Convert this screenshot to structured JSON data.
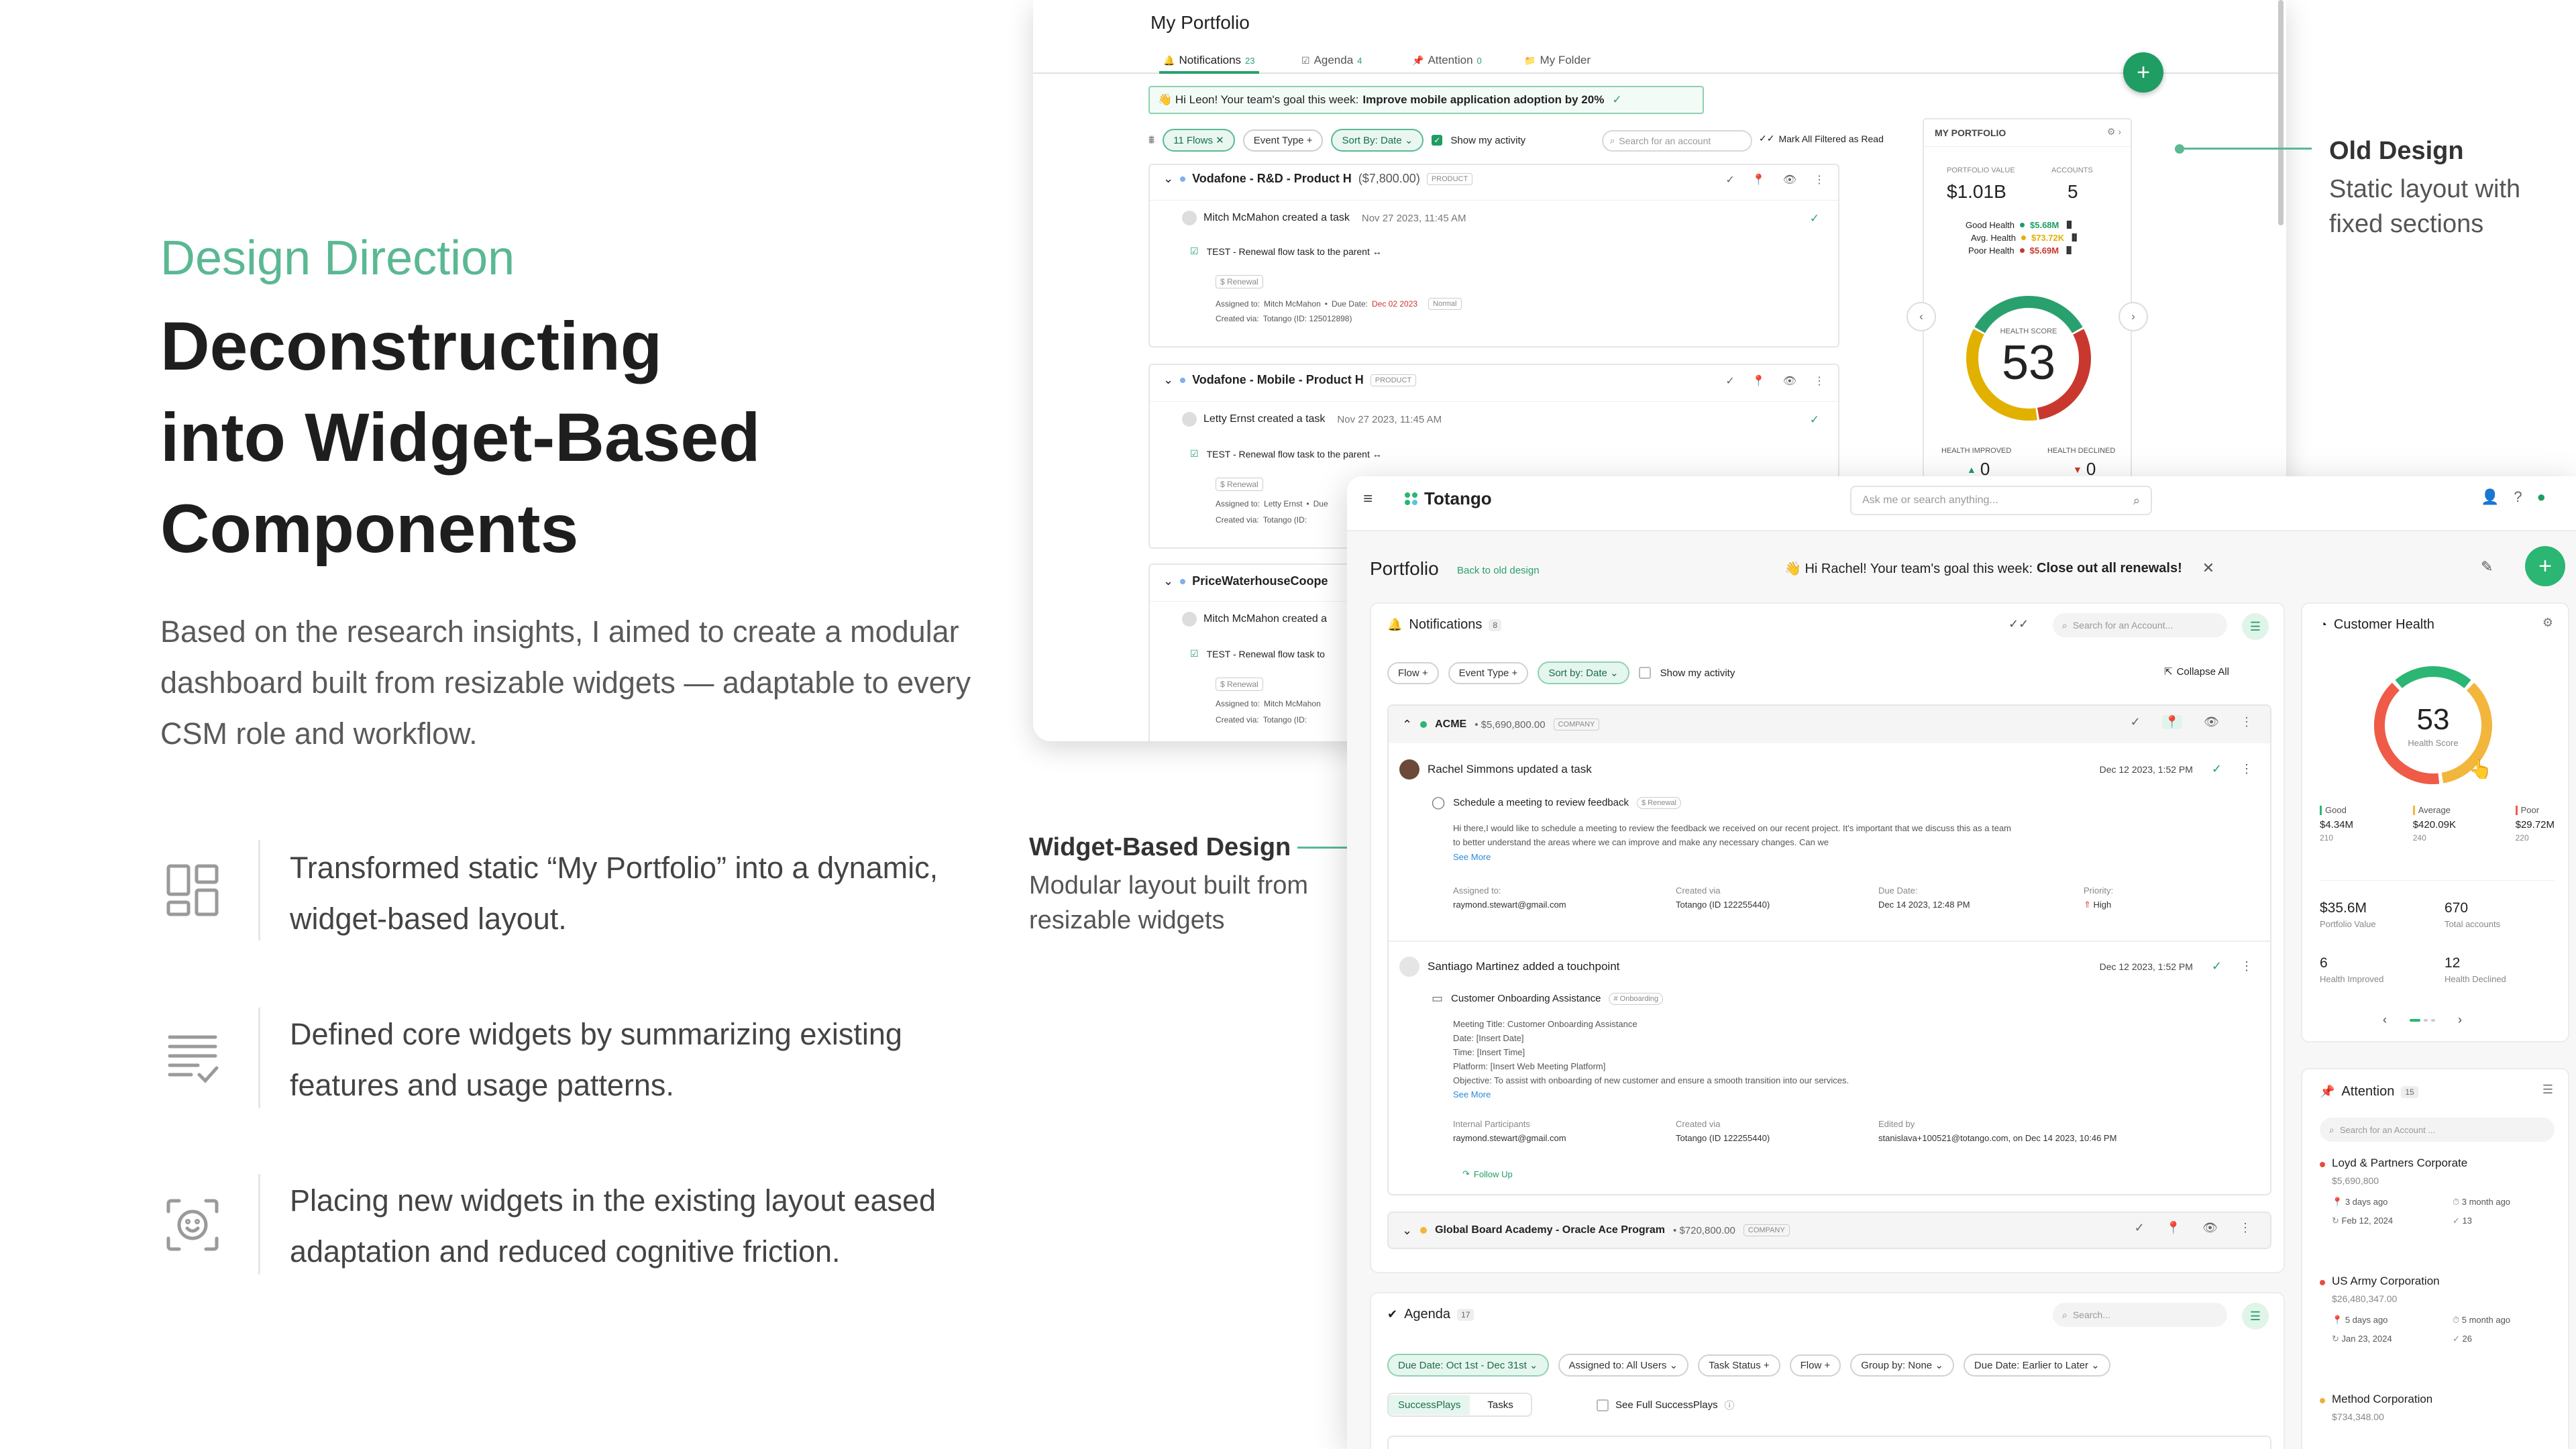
{
  "left": {
    "section_label": "Design Direction",
    "headline_lines": [
      "Deconstructing",
      "into Widget-Based",
      "Components"
    ],
    "intro": "Based on the research insights, I aimed to create a modular dashboard built from resizable widgets — adaptable to every CSM role and workflow.",
    "features": [
      {
        "icon": "widget-grid-icon",
        "text": "Transformed static “My Portfolio” into a dynamic, widget-based layout."
      },
      {
        "icon": "summary-list-icon",
        "text": "Defined core widgets by summarizing existing features and usage patterns."
      },
      {
        "icon": "face-scan-icon",
        "text": "Placing new widgets in the existing layout eased adaptation and reduced cognitive friction."
      }
    ]
  },
  "annotations": {
    "old": {
      "title": "Old Design",
      "desc": "Static layout with fixed sections"
    },
    "new": {
      "title": "Widget-Based Design",
      "desc": "Modular layout built from resizable widgets"
    }
  },
  "accent_color": "#5ab893",
  "old_design": {
    "title": "My Portfolio",
    "tabs": [
      {
        "label": "Notifications",
        "count": "23"
      },
      {
        "label": "Agenda",
        "count": "4"
      },
      {
        "label": "Attention",
        "count": "0"
      },
      {
        "label": "My Folder",
        "count": ""
      }
    ],
    "goal_prefix": "👋 Hi Leon! Your team's goal this week:",
    "goal_bold": "Improve mobile application adoption by 20%",
    "filters": {
      "flows": "11 Flows",
      "event_type": "Event Type",
      "sort": "Sort By: Date",
      "show_activity": "Show my activity",
      "search_placeholder": "Search for an account",
      "mark_all": "Mark All Filtered as Read"
    },
    "groups": [
      {
        "account": "Vodafone - R&D - Product H",
        "amount": "($7,800.00)",
        "tag": "PRODUCT",
        "event": "Mitch McMahon created a task",
        "time": "Nov 27 2023, 11:45 AM",
        "task": "TEST - Renewal flow task to the parent ↔",
        "badge": "$ Renewal",
        "assigned_label": "Assigned to:",
        "assigned": "Mitch McMahon",
        "due_label": "Due Date:",
        "due": "Dec 02 2023",
        "priority": "Normal",
        "created_label": "Created via:",
        "created": "Totango (ID: 125012898)"
      },
      {
        "account": "Vodafone - Mobile - Product H",
        "amount": "",
        "tag": "PRODUCT",
        "event": "Letty Ernst created a task",
        "time": "Nov 27 2023, 11:45 AM",
        "task": "TEST - Renewal flow task to the parent ↔",
        "badge": "$ Renewal",
        "assigned_label": "Assigned to:",
        "assigned": "Letty Ernst",
        "due_label": "Due",
        "due": "",
        "priority": "",
        "created_label": "Created via:",
        "created": "Totango (ID:"
      },
      {
        "account": "PriceWaterhouseCoope",
        "amount": "",
        "tag": "",
        "event": "Mitch McMahon created a",
        "time": "",
        "task": "TEST - Renewal flow task to",
        "badge": "$ Renewal",
        "assigned_label": "Assigned to:",
        "assigned": "Mitch McMahon",
        "due_label": "",
        "due": "",
        "priority": "",
        "created_label": "Created via:",
        "created": "Totango (ID:"
      }
    ],
    "portfolio": {
      "title": "MY PORTFOLIO",
      "value_label": "PORTFOLIO VALUE",
      "value": "$1.01B",
      "accounts_label": "ACCOUNTS",
      "accounts": "5",
      "health_rows": [
        {
          "label": "Good Health",
          "value": "$5.68M",
          "color": "#1f9d63"
        },
        {
          "label": "Avg. Health",
          "value": "$73.72K",
          "color": "#e2b100"
        },
        {
          "label": "Poor Health",
          "value": "$5.69M",
          "color": "#c9382e"
        }
      ],
      "score_label": "HEALTH SCORE",
      "score": "53",
      "improved_label": "HEALTH IMPROVED",
      "improved": "0",
      "declined_label": "HEALTH DECLINED",
      "declined": "0"
    }
  },
  "new_design": {
    "brand": "Totango",
    "search_placeholder": "Ask me or search anything...",
    "page_title": "Portfolio",
    "back_link": "Back to old design",
    "goal_prefix": "👋 Hi Rachel! Your team's goal this week:",
    "goal_bold": "Close out all renewals!",
    "notifications": {
      "title": "Notifications",
      "count": "8",
      "search_placeholder": "Search for an Account...",
      "filters": {
        "flow": "Flow",
        "event_type": "Event Type",
        "sort": "Sort by: Date",
        "show_activity": "Show my activity",
        "collapse": "Collapse All"
      },
      "group1": {
        "account": "ACME",
        "amount": "• $5,690,800.00",
        "tag": "COMPANY"
      },
      "item1": {
        "title": "Rachel Simmons updated a task",
        "time": "Dec 12 2023, 1:52 PM",
        "task": "Schedule a meeting to review feedback",
        "badge": "$ Renewal",
        "body": "Hi there,I would like to schedule a meeting to review the feedback we received on our recent project. It's important that we discuss this as a team to better understand the areas where we can improve and make any necessary changes. Can we",
        "see_more": "See More",
        "fields": [
          {
            "label": "Assigned to:",
            "value": "raymond.stewart@gmail.com"
          },
          {
            "label": "Created via",
            "value": "Totango (ID 122255440)"
          },
          {
            "label": "Due Date:",
            "value": "Dec 14 2023, 12:48 PM"
          },
          {
            "label": "Priority:",
            "value": "High"
          }
        ]
      },
      "item2": {
        "title": "Santiago Martinez added a touchpoint",
        "time": "Dec 12 2023, 1:52 PM",
        "task": "Customer Onboarding Assistance",
        "badge": "# Onboarding",
        "lines": [
          "Meeting Title: Customer Onboarding Assistance",
          "Date: [Insert Date]",
          "Time: [Insert Time]",
          "Platform: [Insert Web Meeting Platform]",
          "Objective: To assist with onboarding of new customer and ensure a smooth transition into our services."
        ],
        "see_more": "See More",
        "fields": [
          {
            "label": "Internal Participants",
            "value": "raymond.stewart@gmail.com"
          },
          {
            "label": "Created via",
            "value": "Totango (ID 122255440)"
          },
          {
            "label": "Edited by",
            "value": "stanislava+100521@totango.com, on Dec 14 2023, 10:46 PM"
          }
        ],
        "follow_up": "Follow Up"
      },
      "group2": {
        "account": "Global Board Academy - Oracle Ace Program",
        "amount": "• $720,800.00",
        "tag": "COMPANY"
      }
    },
    "agenda": {
      "title": "Agenda",
      "count": "17",
      "search_placeholder": "Search...",
      "filters": [
        "Due Date: Oct 1st - Dec 31st",
        "Assigned to: All Users",
        "Task Status",
        "Flow",
        "Group by: None",
        "Due Date: Earlier to Later"
      ],
      "tabs": [
        "SuccessPlays",
        "Tasks"
      ],
      "see_full": "See Full SuccessPlays"
    },
    "customer_health": {
      "title": "Customer Health",
      "score": "53",
      "score_label": "Health Score",
      "segments": [
        {
          "label": "Good",
          "value": "$4.34M",
          "count": "210",
          "color": "#2bb673"
        },
        {
          "label": "Average",
          "value": "$420.09K",
          "count": "240",
          "color": "#f2b63c"
        },
        {
          "label": "Poor",
          "value": "$29.72M",
          "count": "220",
          "color": "#ef5b47"
        }
      ],
      "stats": [
        {
          "value": "$35.6M",
          "label": "Portfolio Value"
        },
        {
          "value": "670",
          "label": "Total accounts"
        },
        {
          "value": "6",
          "label": "Health Improved"
        },
        {
          "value": "12",
          "label": "Health Declined"
        }
      ]
    },
    "attention": {
      "title": "Attention",
      "count": "15",
      "search_placeholder": "Search for an Account ...",
      "items": [
        {
          "name": "Loyd & Partners Corporate",
          "value": "$5,690,800",
          "ago": "3 days ago",
          "ago2": "3 month ago",
          "date": "Feb 12, 2024",
          "num": "13",
          "color": "#e84d3d"
        },
        {
          "name": "US Army Corporation",
          "value": "$26,480,347.00",
          "ago": "5 days ago",
          "ago2": "5 month ago",
          "date": "Jan 23, 2024",
          "num": "26",
          "color": "#e84d3d"
        },
        {
          "name": "Method Corporation",
          "value": "$734,348.00",
          "ago": "",
          "ago2": "",
          "date": "",
          "num": "",
          "color": "#e8b33d"
        }
      ]
    }
  }
}
